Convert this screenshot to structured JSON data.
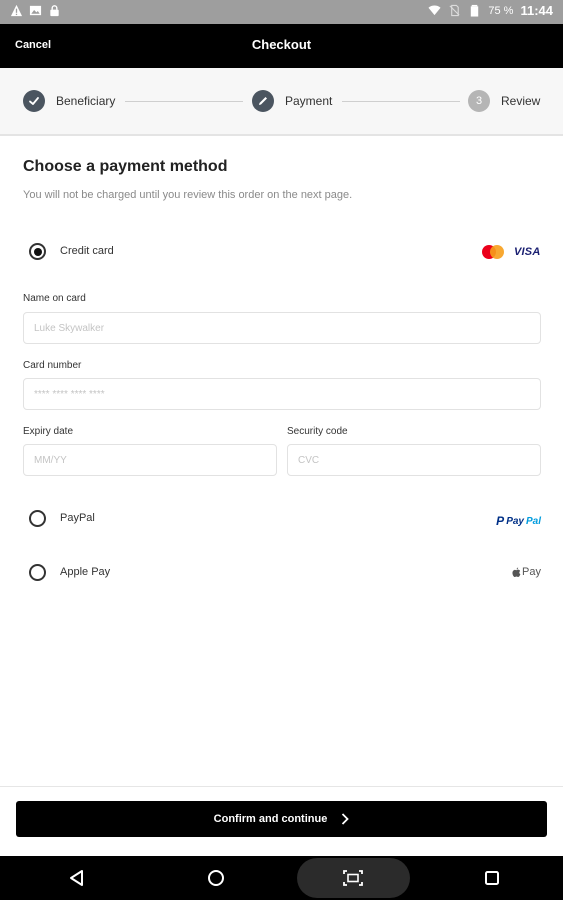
{
  "status_bar": {
    "battery": "75 %",
    "time": "11:44",
    "icons": [
      "warning-icon",
      "image-icon",
      "lock-icon",
      "wifi-icon",
      "no-sim-icon",
      "battery-icon"
    ]
  },
  "header": {
    "cancel_label": "Cancel",
    "title": "Checkout"
  },
  "stepper": {
    "steps": [
      {
        "label": "Beneficiary",
        "state": "done"
      },
      {
        "label": "Payment",
        "state": "current"
      },
      {
        "label": "Review",
        "state": "pending",
        "number": "3"
      }
    ]
  },
  "payment": {
    "title": "Choose a payment method",
    "subtitle": "You will not be charged until you review this order on the next page.",
    "credit_card": {
      "label": "Credit card",
      "selected": true,
      "brands": [
        "mastercard",
        "VISA"
      ],
      "name_label": "Name on card",
      "name_placeholder": "Luke Skywalker",
      "number_label": "Card number",
      "number_placeholder": "**** **** **** ****",
      "expiry_label": "Expiry date",
      "expiry_placeholder": "MM/YY",
      "cvc_label": "Security code",
      "cvc_placeholder": "CVC"
    },
    "paypal": {
      "label": "PayPal",
      "selected": false,
      "logo_text_a": "Pay",
      "logo_text_b": "Pal"
    },
    "apple_pay": {
      "label": "Apple Pay",
      "selected": false,
      "logo_text": "Pay"
    }
  },
  "footer": {
    "confirm_label": "Confirm and continue"
  },
  "colors": {
    "header_bg": "#000000",
    "step_done": "#4b5560",
    "step_pending": "#b5b5b5",
    "mastercard_red": "#eb001b",
    "mastercard_orange": "#f79e1b",
    "visa_blue": "#1a1f71",
    "paypal_dark": "#003087",
    "paypal_light": "#009cde"
  }
}
